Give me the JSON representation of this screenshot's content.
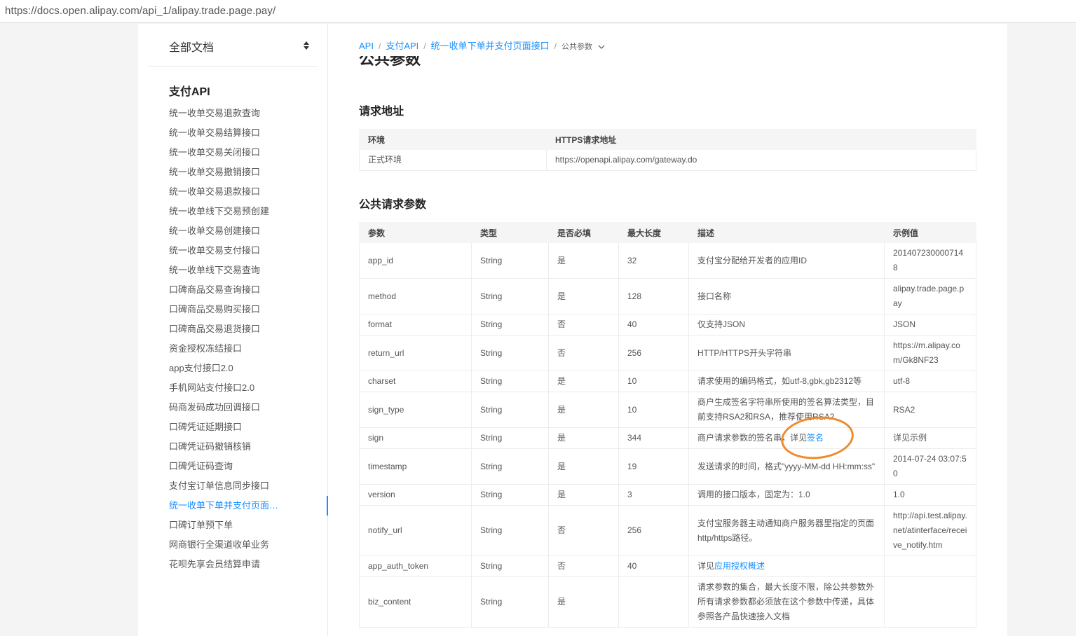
{
  "browser": {
    "url": "https://docs.open.alipay.com/api_1/alipay.trade.page.pay/"
  },
  "sidebar": {
    "all_docs_label": "全部文档",
    "section_title": "支付API",
    "items": [
      {
        "label": "统一收单交易退款查询",
        "active": false
      },
      {
        "label": "统一收单交易结算接口",
        "active": false
      },
      {
        "label": "统一收单交易关闭接口",
        "active": false
      },
      {
        "label": "统一收单交易撤销接口",
        "active": false
      },
      {
        "label": "统一收单交易退款接口",
        "active": false
      },
      {
        "label": "统一收单线下交易预创建",
        "active": false
      },
      {
        "label": "统一收单交易创建接口",
        "active": false
      },
      {
        "label": "统一收单交易支付接口",
        "active": false
      },
      {
        "label": "统一收单线下交易查询",
        "active": false
      },
      {
        "label": "口碑商品交易查询接口",
        "active": false
      },
      {
        "label": "口碑商品交易购买接口",
        "active": false
      },
      {
        "label": "口碑商品交易退货接口",
        "active": false
      },
      {
        "label": "资金授权冻结接口",
        "active": false
      },
      {
        "label": "app支付接口2.0",
        "active": false
      },
      {
        "label": "手机网站支付接口2.0",
        "active": false
      },
      {
        "label": "码商发码成功回调接口",
        "active": false
      },
      {
        "label": "口碑凭证延期接口",
        "active": false
      },
      {
        "label": "口碑凭证码撤销核销",
        "active": false
      },
      {
        "label": "口碑凭证码查询",
        "active": false
      },
      {
        "label": "支付宝订单信息同步接口",
        "active": false
      },
      {
        "label": "统一收单下单并支付页面接口",
        "active": true
      },
      {
        "label": "口碑订单预下单",
        "active": false
      },
      {
        "label": "网商银行全渠道收单业务",
        "active": false
      },
      {
        "label": "花呗先享会员结算申请",
        "active": false
      }
    ]
  },
  "breadcrumb": {
    "items": [
      "API",
      "支付API",
      "统一收单下单并支付页面接口"
    ],
    "separator": "/",
    "current": "公共参数"
  },
  "main": {
    "cut_heading": "公共参数",
    "request_address_title": "请求地址",
    "env_table": {
      "headers": [
        "环境",
        "HTTPS请求地址"
      ],
      "rows": [
        [
          "正式环境",
          "https://openapi.alipay.com/gateway.do"
        ]
      ]
    },
    "public_params_title": "公共请求参数",
    "params_table": {
      "headers": [
        "参数",
        "类型",
        "是否必填",
        "最大长度",
        "描述",
        "示例值"
      ],
      "rows": [
        {
          "name": "app_id",
          "type": "String",
          "required": "是",
          "max": "32",
          "desc": "支付宝分配给开发者的应用ID",
          "desc_link": "",
          "example": "2014072300007148"
        },
        {
          "name": "method",
          "type": "String",
          "required": "是",
          "max": "128",
          "desc": "接口名称",
          "desc_link": "",
          "example": "alipay.trade.page.pay"
        },
        {
          "name": "format",
          "type": "String",
          "required": "否",
          "max": "40",
          "desc": "仅支持JSON",
          "desc_link": "",
          "example": "JSON"
        },
        {
          "name": "return_url",
          "type": "String",
          "required": "否",
          "max": "256",
          "desc": "HTTP/HTTPS开头字符串",
          "desc_link": "",
          "example": "https://m.alipay.com/Gk8NF23"
        },
        {
          "name": "charset",
          "type": "String",
          "required": "是",
          "max": "10",
          "desc": "请求使用的编码格式，如utf-8,gbk,gb2312等",
          "desc_link": "",
          "example": "utf-8"
        },
        {
          "name": "sign_type",
          "type": "String",
          "required": "是",
          "max": "10",
          "desc": "商户生成签名字符串所使用的签名算法类型，目前支持RSA2和RSA，推荐使用RSA2",
          "desc_link": "",
          "example": "RSA2"
        },
        {
          "name": "sign",
          "type": "String",
          "required": "是",
          "max": "344",
          "desc": "商户请求参数的签名串，详见",
          "desc_link": "签名",
          "example": "详见示例"
        },
        {
          "name": "timestamp",
          "type": "String",
          "required": "是",
          "max": "19",
          "desc": "发送请求的时间，格式\"yyyy-MM-dd HH:mm:ss\"",
          "desc_link": "",
          "example": "2014-07-24 03:07:50"
        },
        {
          "name": "version",
          "type": "String",
          "required": "是",
          "max": "3",
          "desc": "调用的接口版本，固定为：1.0",
          "desc_link": "",
          "example": "1.0"
        },
        {
          "name": "notify_url",
          "type": "String",
          "required": "否",
          "max": "256",
          "desc": "支付宝服务器主动通知商户服务器里指定的页面http/https路径。",
          "desc_link": "",
          "example": "http://api.test.alipay.net/atinterface/receive_notify.htm"
        },
        {
          "name": "app_auth_token",
          "type": "String",
          "required": "否",
          "max": "40",
          "desc": "详见",
          "desc_link": "应用授权概述",
          "example": ""
        },
        {
          "name": "biz_content",
          "type": "String",
          "required": "是",
          "max": "",
          "desc": "请求参数的集合，最大长度不限，除公共参数外所有请求参数都必须放在这个参数中传递，具体参照各产品快速接入文档",
          "desc_link": "",
          "example": ""
        }
      ]
    }
  },
  "colors": {
    "link": "#1890ff",
    "annotation": "#f08a2c"
  }
}
